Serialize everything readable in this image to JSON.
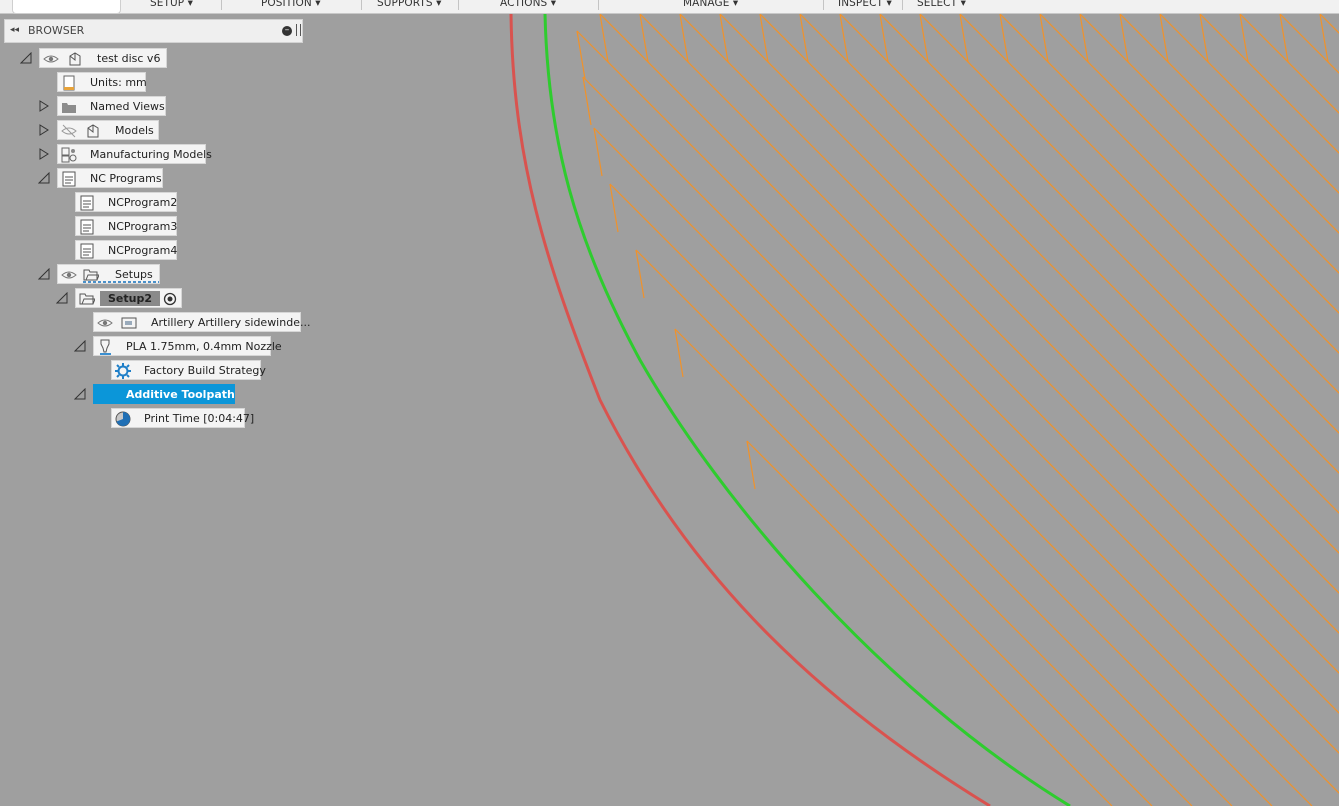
{
  "toolbar": {
    "menus": [
      "SETUP",
      "POSITION",
      "SUPPORTS",
      "ACTIONS",
      "MANAGE",
      "INSPECT",
      "SELECT"
    ]
  },
  "browser": {
    "title": "BROWSER",
    "items": [
      {
        "label": "test disc v6"
      },
      {
        "label": "Units: mm"
      },
      {
        "label": "Named Views"
      },
      {
        "label": "Models"
      },
      {
        "label": "Manufacturing Models"
      },
      {
        "label": "NC Programs"
      },
      {
        "label": "NCProgram2"
      },
      {
        "label": "NCProgram3"
      },
      {
        "label": "NCProgram4"
      },
      {
        "label": "Setups"
      },
      {
        "label": "Setup2"
      },
      {
        "label": "Artillery Artillery sidewinde..."
      },
      {
        "label": "PLA 1.75mm, 0.4mm Nozzle"
      },
      {
        "label": "Factory Build Strategy"
      },
      {
        "label": "Additive Toolpath"
      },
      {
        "label": "Print Time [0:04:47]"
      }
    ]
  },
  "colors": {
    "outer_path": "#d9534f",
    "inner_path": "#2ecc2e",
    "infill": "#f0922b",
    "selection": "#0b96d9"
  }
}
